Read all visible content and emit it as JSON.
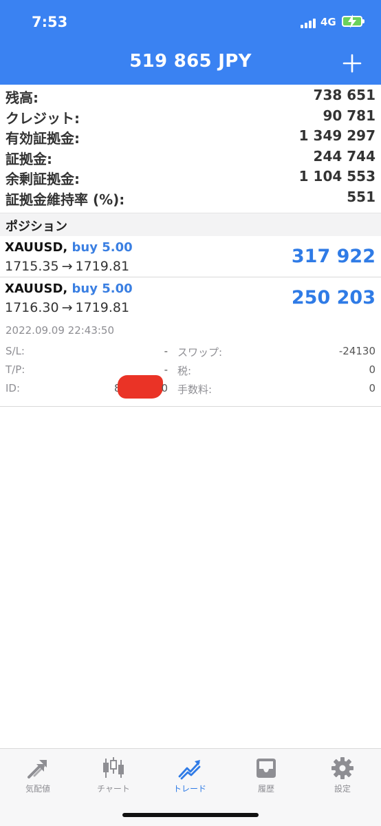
{
  "status_bar": {
    "time": "7:53",
    "network": "4G"
  },
  "header": {
    "title": "519 865 JPY"
  },
  "summary": [
    {
      "label": "残高:",
      "value": "738 651"
    },
    {
      "label": "クレジット:",
      "value": "90 781"
    },
    {
      "label": "有効証拠金:",
      "value": "1 349 297"
    },
    {
      "label": "証拠金:",
      "value": "244 744"
    },
    {
      "label": "余剰証拠金:",
      "value": "1 104 553"
    },
    {
      "label": "証拠金維持率 (%):",
      "value": "551"
    }
  ],
  "positions_header": "ポジション",
  "positions": [
    {
      "symbol": "XAUUSD,",
      "side": "buy 5.00",
      "open_price": "1715.35",
      "arrow": "→",
      "current_price": "1719.81",
      "profit": "317 922"
    },
    {
      "symbol": "XAUUSD,",
      "side": "buy 5.00",
      "open_price": "1716.30",
      "arrow": "→",
      "current_price": "1719.81",
      "profit": "250 203"
    }
  ],
  "detail": {
    "timestamp": "2022.09.09 22:43:50",
    "sl_label": "S/L:",
    "sl_value": "-",
    "tp_label": "T/P:",
    "tp_value": "-",
    "id_label": "ID:",
    "id_prefix": "8",
    "id_suffix": "0",
    "swap_label": "スワップ:",
    "swap_value": "-24130",
    "tax_label": "税:",
    "tax_value": "0",
    "commission_label": "手数料:",
    "commission_value": "0"
  },
  "tabs": [
    {
      "label": "気配値",
      "icon": "quotes-arrows-icon",
      "active": false
    },
    {
      "label": "チャート",
      "icon": "candlestick-chart-icon",
      "active": false
    },
    {
      "label": "トレード",
      "icon": "trade-trend-icon",
      "active": true
    },
    {
      "label": "履歴",
      "icon": "history-inbox-icon",
      "active": false
    },
    {
      "label": "設定",
      "icon": "settings-gear-icon",
      "active": false
    }
  ],
  "colors": {
    "header_bg": "#3a82f2",
    "accent_blue": "#2f7be6",
    "redaction": "#ea3326"
  }
}
